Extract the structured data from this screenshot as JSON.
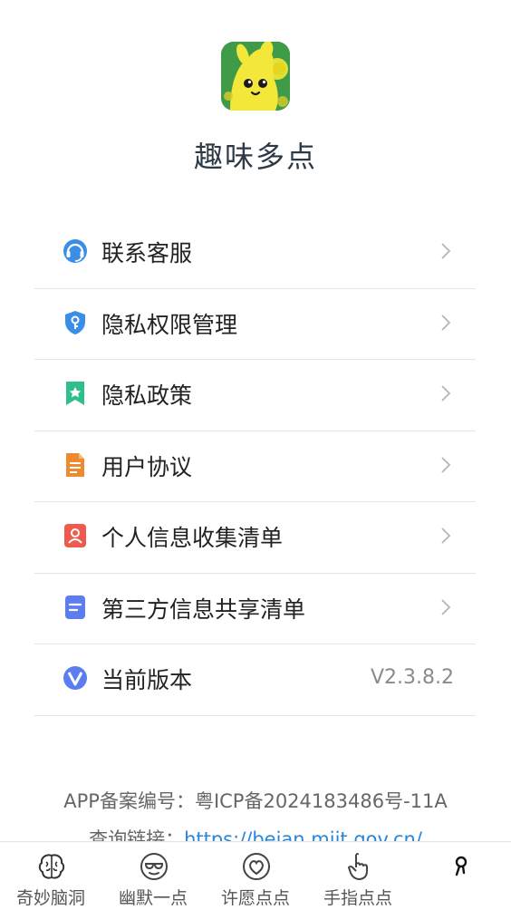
{
  "app": {
    "name": "趣味多点",
    "icon": "app-logo-icon"
  },
  "menu": {
    "items": [
      {
        "label": "联系客服",
        "icon": "headset-icon",
        "color": "#3a8ee6"
      },
      {
        "label": "隐私权限管理",
        "icon": "shield-key-icon",
        "color": "#3a8ee6"
      },
      {
        "label": "隐私政策",
        "icon": "bookmark-star-icon",
        "color": "#2fbf8a"
      },
      {
        "label": "用户协议",
        "icon": "document-icon",
        "color": "#f08a2e"
      },
      {
        "label": "个人信息收集清单",
        "icon": "person-card-icon",
        "color": "#ef5a4e"
      },
      {
        "label": "第三方信息共享清单",
        "icon": "list-document-icon",
        "color": "#5b7df0"
      },
      {
        "label": "当前版本",
        "icon": "version-v-icon",
        "color": "#5b7df0",
        "value": "V2.3.8.2"
      }
    ]
  },
  "footer": {
    "icp": "APP备案编号：粤ICP备2024183486号-11A",
    "query_label": "查询链接：",
    "query_link": "https://beian.miit.gov.cn/"
  },
  "tabs": [
    {
      "label": "奇妙脑洞",
      "icon": "brain-icon"
    },
    {
      "label": "幽默一点",
      "icon": "sunglasses-face-icon"
    },
    {
      "label": "许愿点点",
      "icon": "heart-circle-icon"
    },
    {
      "label": "手指点点",
      "icon": "pointing-hand-icon"
    },
    {
      "label": "",
      "icon": "person-icon"
    }
  ]
}
